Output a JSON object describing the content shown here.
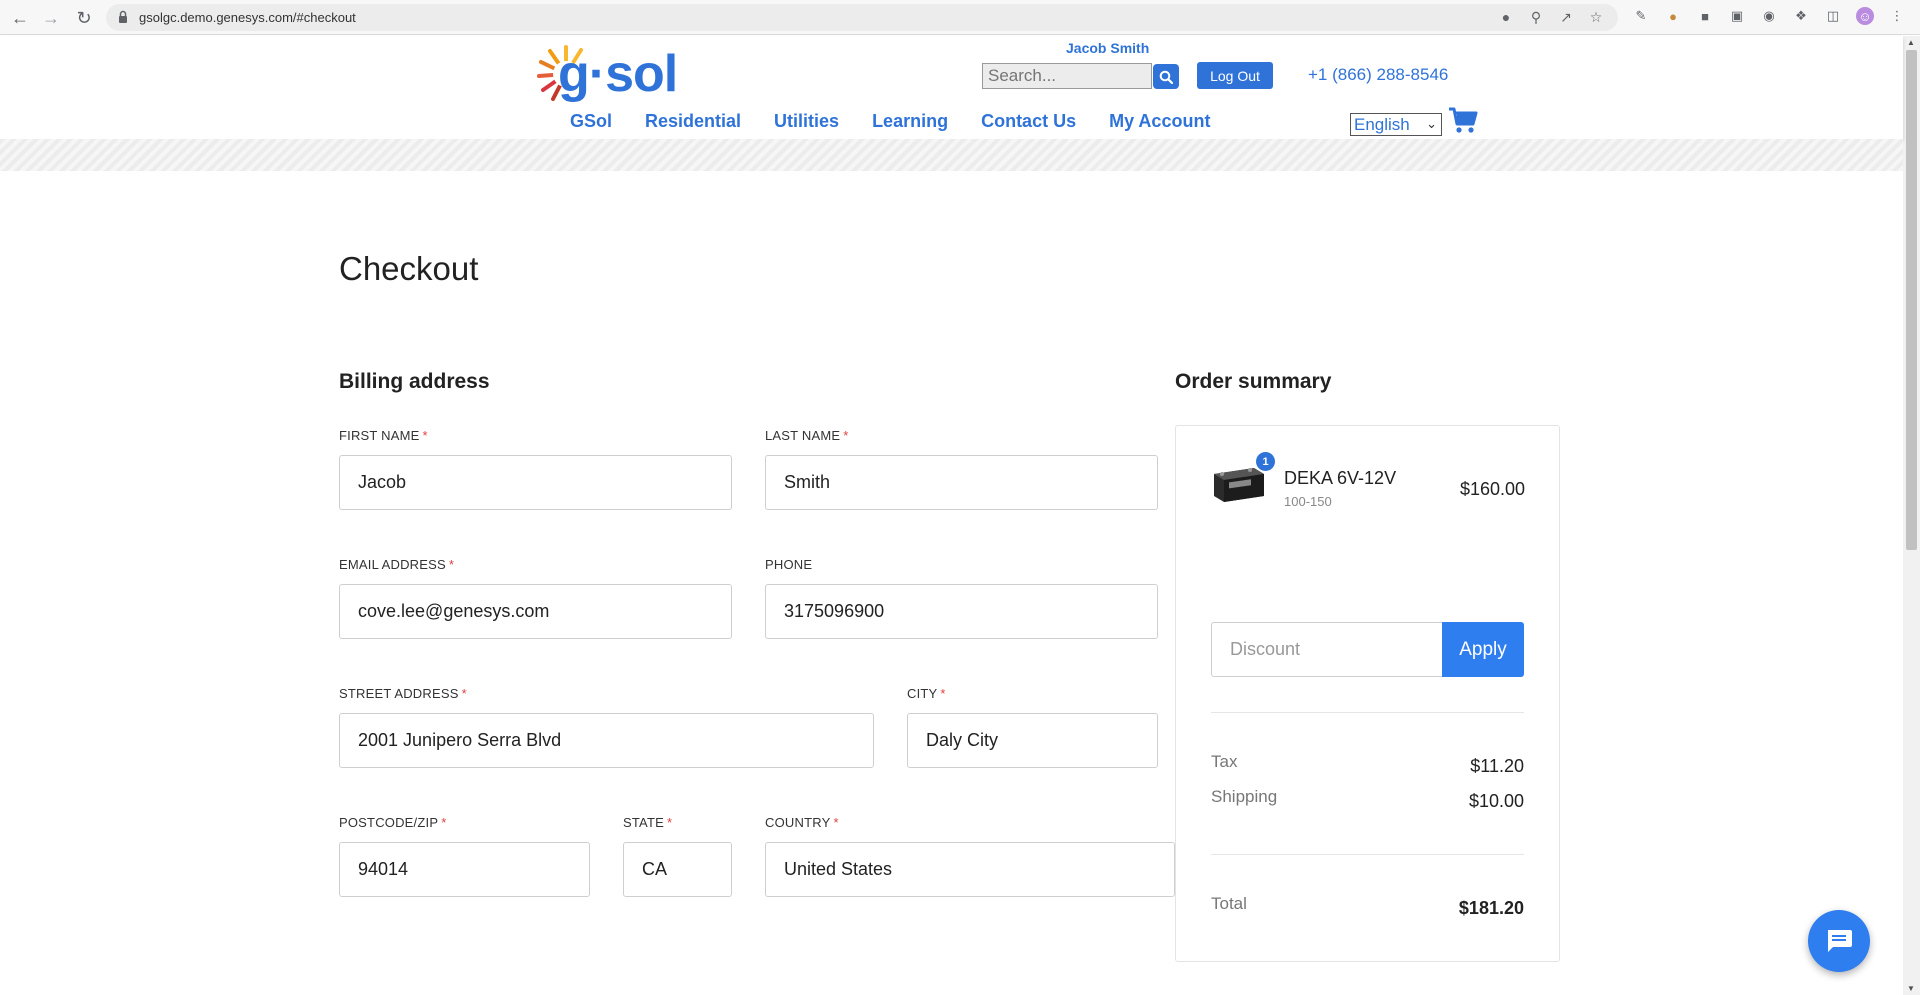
{
  "browser": {
    "url": "gsolgc.demo.genesys.com/#checkout"
  },
  "header": {
    "logo_text": "g·sol",
    "user_name": "Jacob Smith",
    "search_placeholder": "Search...",
    "logout_label": "Log Out",
    "phone": "+1 (866) 288-8546",
    "nav": [
      "GSol",
      "Residential",
      "Utilities",
      "Learning",
      "Contact Us",
      "My Account"
    ],
    "language": "English",
    "brand_color": "#2f73d9"
  },
  "checkout": {
    "title": "Checkout",
    "billing_title": "Billing address",
    "fields": {
      "first_name": {
        "label": "FIRST NAME",
        "value": "Jacob",
        "required": true
      },
      "last_name": {
        "label": "LAST NAME",
        "value": "Smith",
        "required": true
      },
      "email": {
        "label": "EMAIL ADDRESS",
        "value": "cove.lee@genesys.com",
        "required": true
      },
      "phone": {
        "label": "PHONE",
        "value": "3175096900",
        "required": false
      },
      "street": {
        "label": "STREET ADDRESS",
        "value": "2001 Junipero Serra Blvd",
        "required": true
      },
      "city": {
        "label": "CITY",
        "value": "Daly City",
        "required": true
      },
      "postcode": {
        "label": "POSTCODE/ZIP",
        "value": "94014",
        "required": true
      },
      "state": {
        "label": "STATE",
        "value": "CA",
        "required": true
      },
      "country": {
        "label": "COUNTRY",
        "value": "United States",
        "required": true
      }
    },
    "required_mark": "*"
  },
  "summary": {
    "title": "Order summary",
    "item": {
      "name": "DEKA 6V-12V",
      "variant": "100-150",
      "price": "$160.00",
      "quantity": "1"
    },
    "discount_placeholder": "Discount",
    "apply_label": "Apply",
    "tax_label": "Tax",
    "tax_value": "$11.20",
    "shipping_label": "Shipping",
    "shipping_value": "$10.00",
    "total_label": "Total",
    "total_value": "$181.20"
  }
}
